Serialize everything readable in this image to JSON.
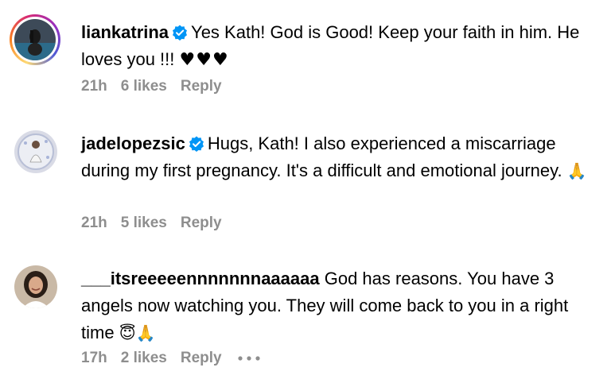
{
  "comments": [
    {
      "username": "liankatrina",
      "text": "Yes Kath! God is Good! Keep your faith in him. He loves you !!!",
      "emoji": "♥♥♥",
      "time": "21h",
      "likes": "6 likes",
      "reply": "Reply",
      "verified": true,
      "has_story": true
    },
    {
      "username": "jadelopezsic",
      "text": "Hugs, Kath! I also experienced a miscarriage during my first pregnancy. It's a difficult and emotional journey.",
      "emoji": "🙏",
      "time": "21h",
      "likes": "5 likes",
      "reply": "Reply",
      "verified": true,
      "has_story": false
    },
    {
      "username": "___itsreeeeennnnnnnaaaaaa",
      "text": "God has reasons. You have 3 angels now watching you. They will come back to you in a right time",
      "emoji": "😇🙏",
      "time": "17h",
      "likes": "2 likes",
      "reply": "Reply",
      "verified": false,
      "has_story": false
    }
  ],
  "colors": {
    "meta_text": "#8e8e8e",
    "verified_badge": "#0095f6"
  },
  "icons": {
    "verified": "verified-badge-icon",
    "more": "more-options-icon"
  }
}
